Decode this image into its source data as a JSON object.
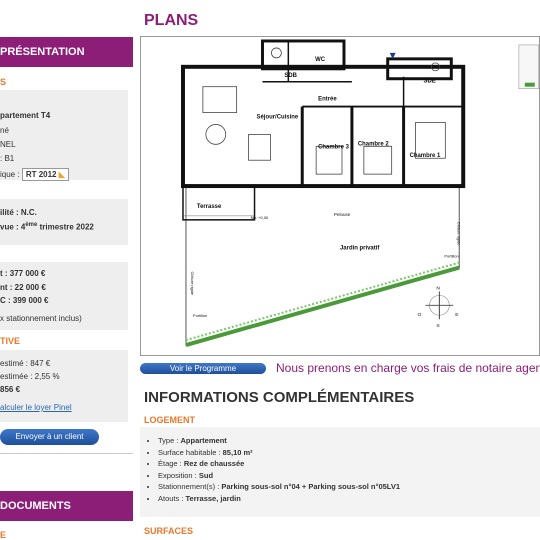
{
  "left": {
    "presentation_header": "PRÉSENTATION",
    "section_label": "S",
    "type": "partement T4",
    "state": "né",
    "tax": "NEL",
    "zone": ": B1",
    "label_prefix": "ique :",
    "rt_badge": "RT 2012",
    "availability": "ilité : N.C.",
    "delivery_prefix": "vue : 4",
    "delivery_sup": "ème",
    "delivery_suffix": "trimestre 2022",
    "price1": "t : 377 000 €",
    "price2": "nt : 22 000 €",
    "price3": "C : 399 000 €",
    "parking_note": "x stationnement inclus)",
    "rent_section": "TIVE",
    "rent_est": "estimé : 847 €",
    "yield_est": "estimée : 2,55 %",
    "rent_other": "856 €",
    "calc_link": "alculer le loyer Pinel",
    "send_button": "Envoyer à un client",
    "documents_header": "DOCUMENTS",
    "doc_sub": "E"
  },
  "plans_title": "PLANS",
  "programme_button": "Voir le Programme",
  "banner": "Nous prenons en charge vos   frais de notaire agenc",
  "info_title": "INFORMATIONS COMPLÉMENTAIRES",
  "logement_head": "LOGEMENT",
  "surfaces_head": "SURFACES",
  "info": [
    {
      "label": "Type : ",
      "value": "Appartement"
    },
    {
      "label": "Surface habitable : ",
      "value": "85,10 m²"
    },
    {
      "label": "Étage : ",
      "value": "Rez de chaussée"
    },
    {
      "label": "Exposition : ",
      "value": "Sud"
    },
    {
      "label": "Stationnement(s) : ",
      "value": "Parking sous-sol n°04 + Parking sous-sol n°05LV1"
    },
    {
      "label": "Atouts : ",
      "value": "Terrasse, jardin"
    }
  ],
  "plan": {
    "rooms": {
      "sdb": "SDB",
      "wc": "WC",
      "sde": "SDE",
      "entree": "Entrée",
      "sejour": "Séjour/Cuisine",
      "ch3": "Chambre 3",
      "ch2": "Chambre 2",
      "ch1": "Chambre 1",
      "terrasse": "Terrasse",
      "jardin": "Jardin privatif",
      "pelouse": "Pelouse",
      "niv": "Niv. +0,00",
      "portillon1": "Portillon",
      "portillon2": "Portillon",
      "clot1": "Clôture rigide",
      "clot2": "Clôture rigide"
    },
    "compass": {
      "n": "N",
      "s": "S",
      "e": "E",
      "o": "O"
    }
  }
}
